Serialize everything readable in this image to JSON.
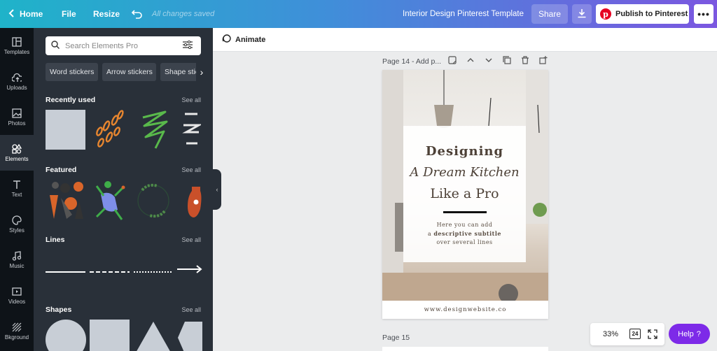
{
  "topbar": {
    "home": "Home",
    "file": "File",
    "resize": "Resize",
    "saved": "All changes saved",
    "title": "Interior Design Pinterest Template",
    "share": "Share",
    "publish": "Publish to Pinterest"
  },
  "rail": [
    {
      "label": "Templates",
      "icon": "templates-icon"
    },
    {
      "label": "Uploads",
      "icon": "upload-icon"
    },
    {
      "label": "Photos",
      "icon": "photos-icon"
    },
    {
      "label": "Elements",
      "icon": "elements-icon"
    },
    {
      "label": "Text",
      "icon": "text-icon"
    },
    {
      "label": "Styles",
      "icon": "palette-icon"
    },
    {
      "label": "Music",
      "icon": "music-icon"
    },
    {
      "label": "Videos",
      "icon": "video-icon"
    },
    {
      "label": "Bkground",
      "icon": "background-icon"
    }
  ],
  "panel": {
    "search_placeholder": "Search Elements Pro",
    "chips": [
      "Word stickers",
      "Arrow stickers",
      "Shape stic"
    ],
    "sections": {
      "recent": "Recently used",
      "featured": "Featured",
      "lines": "Lines",
      "shapes": "Shapes"
    },
    "see_all": "See all"
  },
  "subbar": {
    "animate": "Animate"
  },
  "canvas": {
    "page14_label": "Page 14 - Add p...",
    "page15_label": "Page 15",
    "design": {
      "line1": "Designing",
      "line2": "A Dream Kitchen",
      "line3": "Like a Pro",
      "sub1": "Here you can add",
      "sub2_pre": "a ",
      "sub2_bold": "descriptive subtitle",
      "sub3": "over several lines",
      "website": "www.designwebsite.co"
    }
  },
  "controls": {
    "zoom": "33%",
    "page_count": "24",
    "help": "Help",
    "help_glyph": "?"
  },
  "colors": {
    "accent": "#7d2ae8",
    "pinterest": "#e60023",
    "panel": "#293039"
  }
}
